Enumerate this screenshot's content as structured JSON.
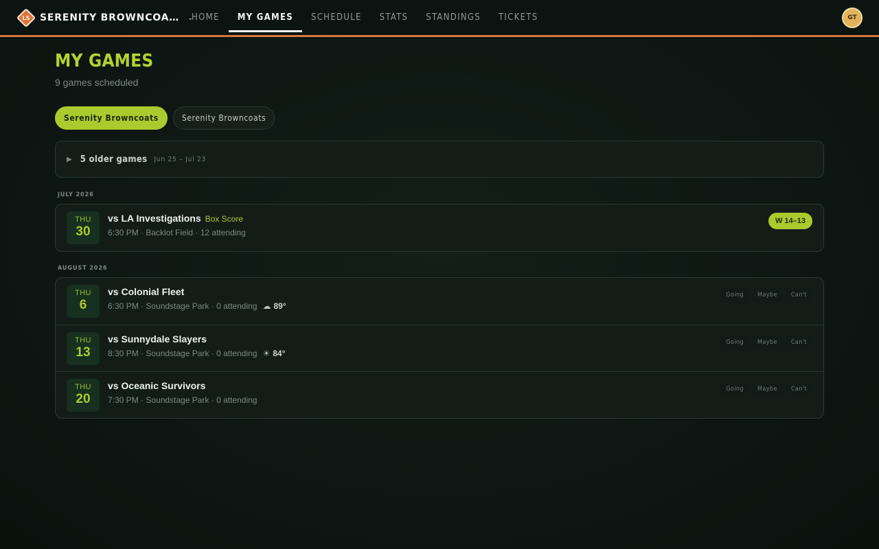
{
  "brand": {
    "logo_text": "LS",
    "name": "SERENITY BROWNCOA…",
    "chevron": "⌄"
  },
  "nav": [
    {
      "label": "HOME",
      "active": false
    },
    {
      "label": "MY GAMES",
      "active": true
    },
    {
      "label": "SCHEDULE",
      "active": false
    },
    {
      "label": "STATS",
      "active": false
    },
    {
      "label": "STANDINGS",
      "active": false
    },
    {
      "label": "TICKETS",
      "active": false
    }
  ],
  "user": {
    "initials": "GT"
  },
  "header": {
    "title": "MY GAMES",
    "subtitle": "9 games scheduled"
  },
  "filters": [
    {
      "label": "Serenity Browncoats",
      "active": true
    },
    {
      "label": "Serenity Browncoats",
      "active": false
    }
  ],
  "older": {
    "toggle_icon": "▶",
    "label": "5 older games",
    "range": "Jun 25 – Jul 23"
  },
  "months": [
    {
      "label": "JULY 2026",
      "games": [
        {
          "dow": "THU",
          "day": "30",
          "opponent": "vs LA Investigations",
          "box_score": "Box Score",
          "meta": "6:30 PM · Backlot Field · 12 attending",
          "result": "W 14–13"
        }
      ]
    },
    {
      "label": "AUGUST 2026",
      "games": [
        {
          "dow": "THU",
          "day": "6",
          "opponent": "vs Colonial Fleet",
          "meta": "6:30 PM · Soundstage Park · 0 attending",
          "weather": {
            "icon": "☁",
            "temp": "89°"
          },
          "rsvp": [
            "Going",
            "Maybe",
            "Can't"
          ]
        },
        {
          "dow": "THU",
          "day": "13",
          "opponent": "vs Sunnydale Slayers",
          "meta": "8:30 PM · Soundstage Park · 0 attending",
          "weather": {
            "icon": "☀",
            "temp": "84°"
          },
          "rsvp": [
            "Going",
            "Maybe",
            "Can't"
          ]
        },
        {
          "dow": "THU",
          "day": "20",
          "opponent": "vs Oceanic Survivors",
          "meta": "7:30 PM · Soundstage Park · 0 attending",
          "rsvp": [
            "Going",
            "Maybe",
            "Can't"
          ]
        }
      ]
    }
  ],
  "colors": {
    "accent": "#a9cb2e",
    "brand_orange": "#d9783a",
    "background": "#0d1713"
  }
}
